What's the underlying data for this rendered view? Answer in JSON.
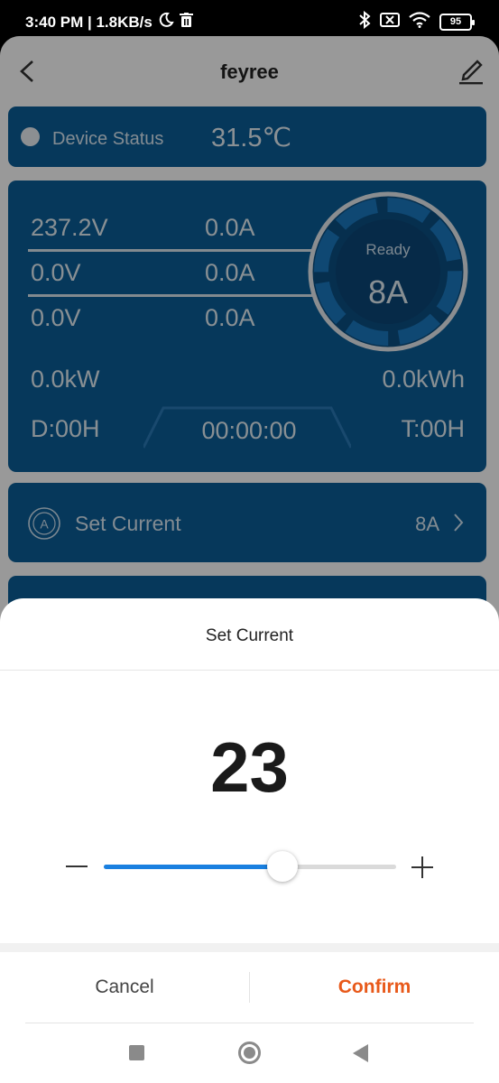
{
  "status_bar": {
    "time_speed": "3:40 PM | 1.8KB/s",
    "battery": "95"
  },
  "app": {
    "title": "feyree",
    "device_status": {
      "label": "Device Status",
      "temperature": "31.5℃"
    },
    "readings": {
      "v1": "237.2V",
      "a1": "0.0A",
      "v2": "0.0V",
      "a2": "0.0A",
      "v3": "0.0V",
      "a3": "0.0A",
      "power": "0.0kW",
      "energy": "0.0kWh",
      "d_hours": "D:00H",
      "timer": "00:00:00",
      "t_hours": "T:00H"
    },
    "gauge": {
      "state": "Ready",
      "current": "8A"
    },
    "set_current_row": {
      "label": "Set Current",
      "value": "8A"
    }
  },
  "sheet": {
    "title": "Set Current",
    "value": "23",
    "slider_level": 0.61,
    "cancel_label": "Cancel",
    "confirm_label": "Confirm"
  },
  "colors": {
    "card_blue": "#0b5e98",
    "slider_blue": "#1a80e0",
    "confirm_orange": "#e8591a"
  }
}
